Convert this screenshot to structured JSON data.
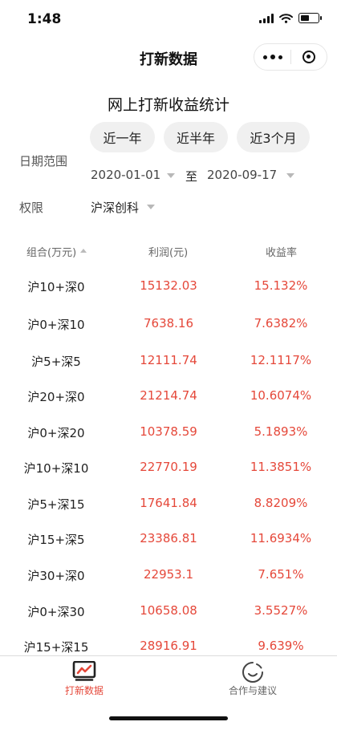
{
  "status_bar": {
    "time": "1:48"
  },
  "nav": {
    "title": "打新数据"
  },
  "page": {
    "title": "网上打新收益统计"
  },
  "range_buttons": [
    "近一年",
    "近半年",
    "近3个月"
  ],
  "filters": {
    "date_label": "日期范围",
    "start_date": "2020-01-01",
    "to_text": "至",
    "end_date": "2020-09-17",
    "permission_label": "权限",
    "permission_value": "沪深创科"
  },
  "table": {
    "headers": [
      "组合(万元)",
      "利润(元)",
      "收益率"
    ],
    "rows": [
      [
        "沪10+深0",
        "15132.03",
        "15.132%"
      ],
      [
        "沪0+深10",
        "7638.16",
        "7.6382%"
      ],
      [
        "沪5+深5",
        "12111.74",
        "12.1117%"
      ],
      [
        "沪20+深0",
        "21214.74",
        "10.6074%"
      ],
      [
        "沪0+深20",
        "10378.59",
        "5.1893%"
      ],
      [
        "沪10+深10",
        "22770.19",
        "11.3851%"
      ],
      [
        "沪5+深15",
        "17641.84",
        "8.8209%"
      ],
      [
        "沪15+深5",
        "23386.81",
        "11.6934%"
      ],
      [
        "沪30+深0",
        "22953.1",
        "7.651%"
      ],
      [
        "沪0+深30",
        "10658.08",
        "3.5527%"
      ],
      [
        "沪15+深15",
        "28916.91",
        "9.639%"
      ]
    ]
  },
  "tabbar": {
    "items": [
      {
        "label": "打新数据",
        "icon": "chart-icon",
        "active": true
      },
      {
        "label": "合作与建议",
        "icon": "smile-icon",
        "active": false
      }
    ]
  },
  "colors": {
    "accent": "#e5483a",
    "inactive": "#666666"
  }
}
